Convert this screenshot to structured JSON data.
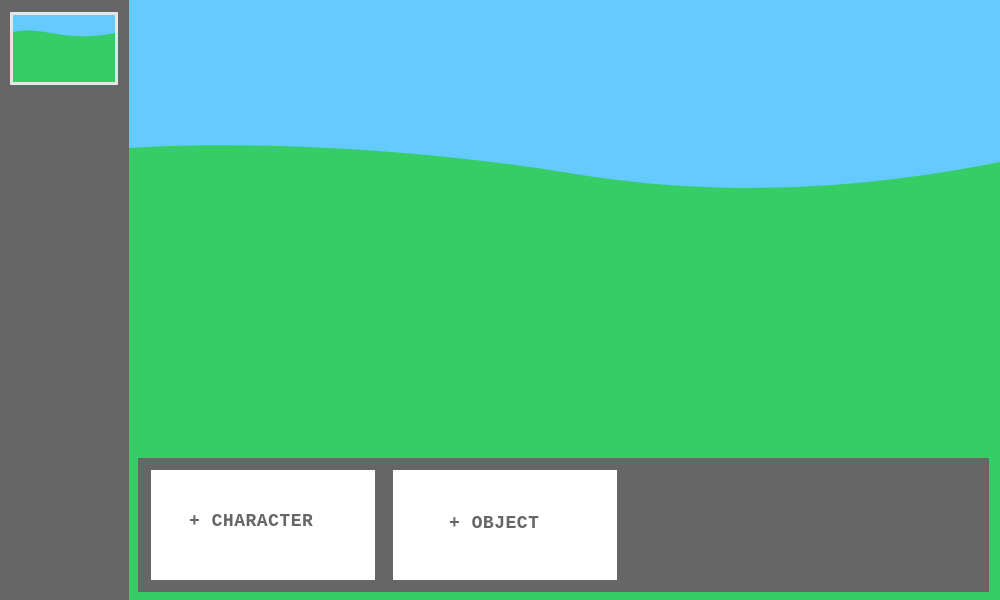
{
  "colors": {
    "sky": "#64caff",
    "grass": "#36cc66",
    "panel": "#666666",
    "thumbnail_border": "#e6e6e6",
    "button_bg": "#ffffff",
    "button_text": "#666666"
  },
  "sidebar": {
    "scene_thumbnails": [
      {
        "icon": "scene-thumbnail-icon"
      }
    ]
  },
  "toolbar": {
    "add_character_label": "+ CHARACTER",
    "add_object_label": "+ OBJECT"
  }
}
